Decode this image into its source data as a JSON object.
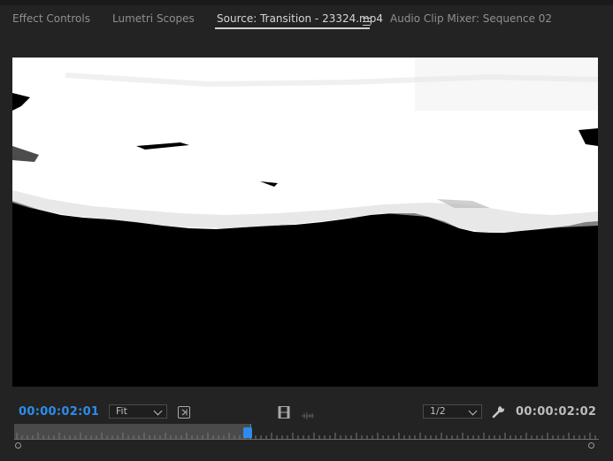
{
  "tabs": [
    {
      "label": "Effect Controls"
    },
    {
      "label": "Lumetri Scopes"
    },
    {
      "label": "Source: Transition - 23324.mp4"
    },
    {
      "label": "Audio Clip Mixer: Sequence 02"
    }
  ],
  "controls": {
    "current_timecode": "00:00:02:01",
    "fit_select": "Fit",
    "resolution_select": "1/2",
    "duration_timecode": "00:00:02:02"
  },
  "scrubber": {
    "playhead_fraction": 0.4
  },
  "icons": {
    "tab_menu": "hamburger-menu-icon",
    "insert": "insert-bracket-icon",
    "export_frame": "film-strip-icon",
    "audio_waveform": "audio-waveform-icon",
    "settings": "wrench-icon"
  },
  "colors": {
    "timecode_accent": "#2d8ceb",
    "panel_background": "#232323"
  }
}
